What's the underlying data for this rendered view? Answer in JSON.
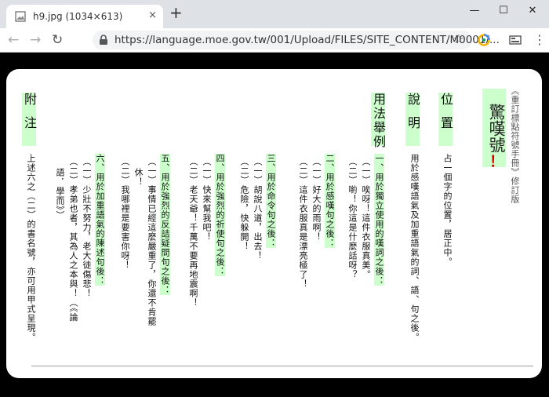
{
  "browser": {
    "tab_title": "h9.jpg (1034×613)",
    "tab_close": "×",
    "new_tab": "+",
    "url": "https://language.moe.gov.tw/001/Upload/FILES/SITE_CONTENT/M0001/...",
    "window_min": "—",
    "window_max": "☐",
    "window_close": "✕",
    "back": "←",
    "forward": "→",
    "reload": "↻",
    "star": "☆",
    "menu": "⋮"
  },
  "document": {
    "side_note": "《重訂標點符號手冊》修訂版",
    "mark_title": "驚嘆號",
    "mark_symbol": "！",
    "sections": {
      "position": {
        "heading": "位置",
        "lines": [
          "占一個字的位置，居正中。"
        ]
      },
      "explanation": {
        "heading": "說明",
        "lines": [
          "用於感嘆語氣及加重語氣的詞、語、句之後。"
        ]
      },
      "usage": {
        "heading": "用法舉例",
        "groups": [
          {
            "title": "一、用於獨立使用的嘆詞之後：",
            "items": [
              "（一）唉呀！這件衣服真美。",
              "（二）喲！你這是什麼話呀？"
            ]
          },
          {
            "title": "二、用於感嘆句之後：",
            "items": [
              "（一）好大的雨啊！",
              "（二）這件衣服真是漂亮極了！"
            ]
          },
          {
            "title": "三、用於命令句之後：",
            "items": [
              "（一）胡說八道，出去！",
              "（二）危險，快躲開！"
            ]
          },
          {
            "title": "四、用於強烈的祈使句之後：",
            "items": [
              "（一）快來幫我吧！",
              "（二）老天爺！千萬不要再地震啊！"
            ]
          },
          {
            "title": "五、用於強烈的反詰疑問句之後：",
            "items": [
              "（一）事情已經這麼嚴重了，你還不肯罷",
              "休！",
              "（二）我哪裡是要害你呀！"
            ]
          },
          {
            "title": "六、用於加重語氣的陳述句後：",
            "items": [
              "（一）少壯不努力，老大徒傷悲！",
              "（二）孝弟也者，其為人之本與！（《論",
              "語．學而》）"
            ]
          }
        ]
      },
      "note": {
        "heading": "附注",
        "lines": [
          "上述六之（二）的書名號，亦可用甲式呈現。"
        ]
      }
    }
  }
}
